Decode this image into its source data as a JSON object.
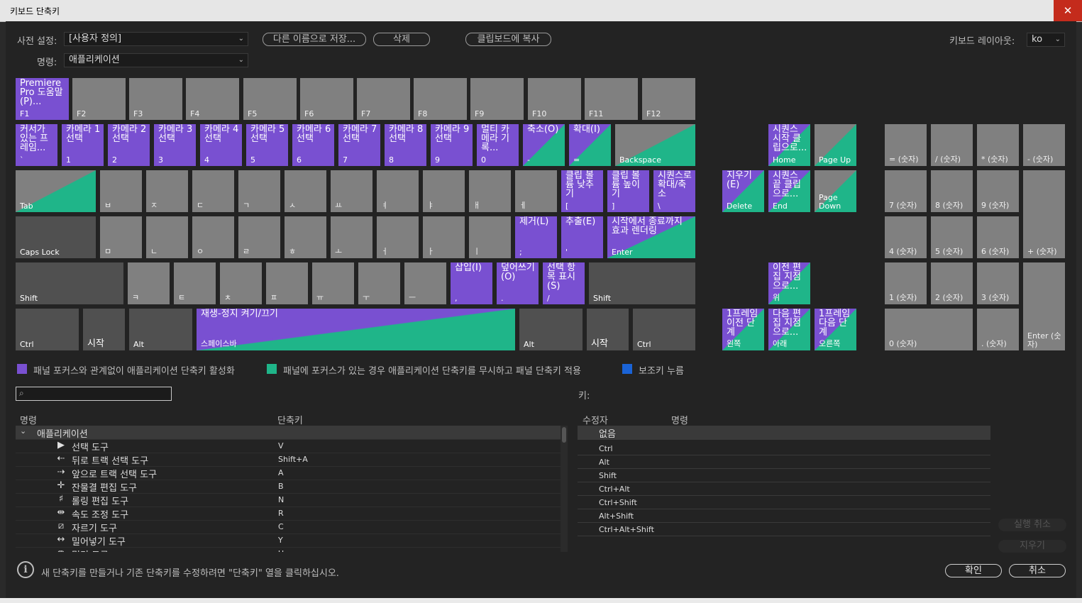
{
  "window": {
    "title": "키보드 단축키",
    "close": "✕"
  },
  "toolbar": {
    "preset_label": "사전 설정:",
    "preset_value": "[사용자 정의]",
    "save_as": "다른 이름으로 저장...",
    "delete": "삭제",
    "copy": "클립보드에 복사",
    "layout_label": "키보드 레이아웃:",
    "layout_value": "ko",
    "command_label": "명령:",
    "command_value": "애플리케이션"
  },
  "keys": {
    "f1": {
      "cmd": "Premiere Pro 도움말(P)...",
      "key": "F1"
    },
    "f2": "F2",
    "f3": "F3",
    "f4": "F4",
    "f5": "F5",
    "f6": "F6",
    "f7": "F7",
    "f8": "F8",
    "f9": "F9",
    "f10": "F10",
    "f11": "F11",
    "f12": "F12",
    "grave": {
      "cmd": "커서가 있는 프레임...",
      "key": "`"
    },
    "k1": {
      "cmd": "카메라 1 선택",
      "key": "1"
    },
    "k2": {
      "cmd": "카메라 2 선택",
      "key": "2"
    },
    "k3": {
      "cmd": "카메라 3 선택",
      "key": "3"
    },
    "k4": {
      "cmd": "카메라 4 선택",
      "key": "4"
    },
    "k5": {
      "cmd": "카메라 5 선택",
      "key": "5"
    },
    "k6": {
      "cmd": "카메라 6 선택",
      "key": "6"
    },
    "k7": {
      "cmd": "카메라 7 선택",
      "key": "7"
    },
    "k8": {
      "cmd": "카메라 8 선택",
      "key": "8"
    },
    "k9": {
      "cmd": "카메라 9 선택",
      "key": "9"
    },
    "k0": {
      "cmd": "멀티 카메라 기록...",
      "key": "0"
    },
    "minus": {
      "cmd": "축소(O)",
      "key": "-"
    },
    "equal": {
      "cmd": "확대(I)",
      "key": "="
    },
    "backspace": "Backspace",
    "tab": "Tab",
    "q": "ㅂ",
    "w": "ㅈ",
    "e": "ㄷ",
    "r": "ㄱ",
    "t": "ㅅ",
    "y": "ㅛ",
    "u": "ㅕ",
    "i": "ㅑ",
    "o": "ㅐ",
    "p": "ㅔ",
    "lbracket": {
      "cmd": "클립 볼륨 낮추기",
      "key": "["
    },
    "rbracket": {
      "cmd": "클립 볼륨 높이기",
      "key": "]"
    },
    "backslash": {
      "cmd": "시퀀스로 확대/축소",
      "key": "\\"
    },
    "caps": "Caps Lock",
    "a": "ㅁ",
    "s": "ㄴ",
    "d": "ㅇ",
    "f": "ㄹ",
    "g": "ㅎ",
    "h": "ㅗ",
    "j": "ㅓ",
    "k": "ㅏ",
    "l": "ㅣ",
    "semicolon": {
      "cmd": "제거(L)",
      "key": ";"
    },
    "quote": {
      "cmd": "추출(E)",
      "key": "'"
    },
    "enter": {
      "cmd": "시작에서 종료까지 효과 렌더링",
      "key": "Enter"
    },
    "lshift": "Shift",
    "z": "ㅋ",
    "x": "ㅌ",
    "c": "ㅊ",
    "v": "ㅍ",
    "b": "ㅠ",
    "n": "ㅜ",
    "m": "ㅡ",
    "comma": {
      "cmd": "삽입(I)",
      "key": ","
    },
    "period": {
      "cmd": "덮어쓰기(O)",
      "key": "."
    },
    "slash": {
      "cmd": "선택 항목 표시(S)",
      "key": "/"
    },
    "rshift": "Shift",
    "lctrl": "Ctrl",
    "lwin": "시작",
    "lalt": "Alt",
    "space": {
      "cmd": "재생-정지 켜기/끄기",
      "key": "스페이스바"
    },
    "ralt": "Alt",
    "rwin": "시작",
    "rctrl": "Ctrl",
    "delete": {
      "cmd": "지우기(E)",
      "key": "Delete"
    },
    "home": {
      "cmd": "시퀀스 시작 클립으로...",
      "key": "Home"
    },
    "pageup": "Page Up",
    "end": {
      "cmd": "시퀀스 끝 클립으로...",
      "key": "End"
    },
    "pagedown": "Page Down",
    "arrow_up": {
      "cmd": "이전 편집 지점으로...",
      "key": "위"
    },
    "arrow_left": {
      "cmd": "1프레임 이전 단계",
      "key": "왼쪽"
    },
    "arrow_down": {
      "cmd": "다음 편집 지점으로...",
      "key": "아래"
    },
    "arrow_right": {
      "cmd": "1프레임 다음 단계",
      "key": "오른쪽"
    },
    "num_eq": "= (숫자)",
    "num_div": "/ (숫자)",
    "num_mul": "* (숫자)",
    "num_sub": "- (숫자)",
    "num7": "7 (숫자)",
    "num8": "8 (숫자)",
    "num9": "9 (숫자)",
    "num_add": "+ (숫자)",
    "num4": "4 (숫자)",
    "num5": "5 (숫자)",
    "num6": "6 (숫자)",
    "num1": "1 (숫자)",
    "num2": "2 (숫자)",
    "num3": "3 (숫자)",
    "num_enter": "Enter (숫자)",
    "num0": "0 (숫자)",
    "num_dot": ". (숫자)"
  },
  "legend": {
    "app": "패널 포커스와 관계없이 애플리케이션 단축키 활성화",
    "panel": "패널에 포커스가 있는 경우 애플리케이션 단축키를 무시하고 패널 단축키 적용",
    "modifier": "보조키 누름",
    "colors": {
      "app": "#7950d1",
      "panel": "#1fb589",
      "modifier": "#1a63d6"
    }
  },
  "search": {
    "placeholder": ""
  },
  "commands": {
    "col_name": "명령",
    "col_shortcut": "단축키",
    "group": "애플리케이션",
    "rows": [
      {
        "icon": "selection-tool-icon",
        "glyph": "▶",
        "name": "선택 도구",
        "shortcut": "V"
      },
      {
        "icon": "track-select-backward-icon",
        "glyph": "⇠",
        "name": "뒤로 트랙 선택 도구",
        "shortcut": "Shift+A"
      },
      {
        "icon": "track-select-forward-icon",
        "glyph": "⇢",
        "name": "앞으로 트랙 선택 도구",
        "shortcut": "A"
      },
      {
        "icon": "ripple-edit-icon",
        "glyph": "✛",
        "name": "잔물결 편집 도구",
        "shortcut": "B"
      },
      {
        "icon": "rolling-edit-icon",
        "glyph": "♯",
        "name": "롤링 편집 도구",
        "shortcut": "N"
      },
      {
        "icon": "rate-stretch-icon",
        "glyph": "⇹",
        "name": "속도 조정 도구",
        "shortcut": "R"
      },
      {
        "icon": "razor-icon",
        "glyph": "⧄",
        "name": "자르기 도구",
        "shortcut": "C"
      },
      {
        "icon": "slip-icon",
        "glyph": "↔",
        "name": "밀어넣기 도구",
        "shortcut": "Y"
      },
      {
        "icon": "slide-icon",
        "glyph": "⇼",
        "name": "밀기 도구",
        "shortcut": "U"
      }
    ]
  },
  "key_panel": {
    "title": "키:",
    "col_modifier": "수정자",
    "col_command": "명령",
    "rows": [
      "없음",
      "Ctrl",
      "Alt",
      "Shift",
      "Ctrl+Alt",
      "Ctrl+Shift",
      "Alt+Shift",
      "Ctrl+Alt+Shift"
    ]
  },
  "buttons": {
    "undo": "실행 취소",
    "clear": "지우기",
    "ok": "확인",
    "cancel": "취소"
  },
  "info_text": "새 단축키를 만들거나 기존 단축키를 수정하려면 \"단축키\" 열을 클릭하십시오."
}
